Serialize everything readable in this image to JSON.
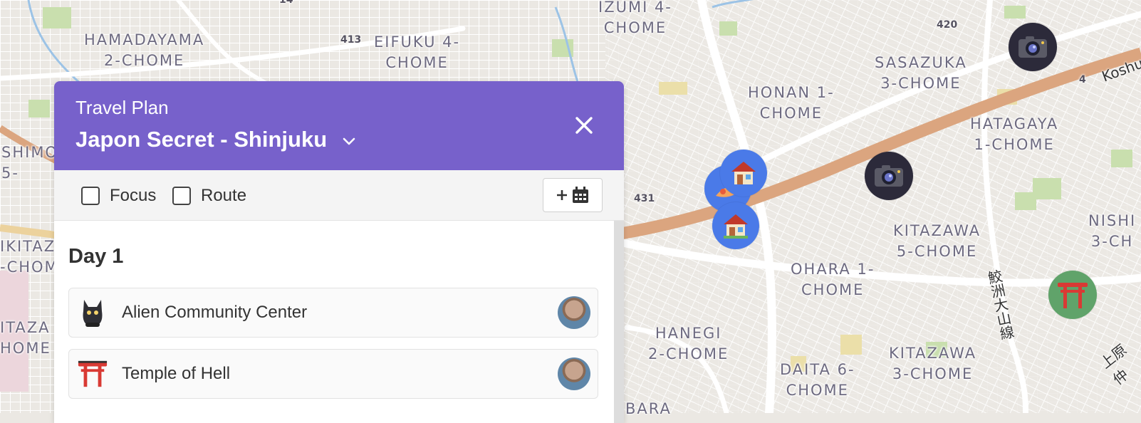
{
  "map": {
    "area_labels": [
      {
        "id": "hamadayama",
        "text": "HAMADAYAMA\n2-CHOME"
      },
      {
        "id": "eifuku",
        "text": "EIFUKU 4-\nCHOME"
      },
      {
        "id": "izumi",
        "text": "IZUMI 4-\nCHOME"
      },
      {
        "id": "sasazuka",
        "text": "SASAZUKA\n3-CHOME"
      },
      {
        "id": "honan",
        "text": "HONAN 1-\nCHOME"
      },
      {
        "id": "hatagaya",
        "text": "HATAGAYA\n1-CHOME"
      },
      {
        "id": "kitazawa5",
        "text": "KITAZAWA\n5-CHOME"
      },
      {
        "id": "ohara",
        "text": "OHARA 1-\nCHOME"
      },
      {
        "id": "hanegi",
        "text": "HANEGI\n2-CHOME"
      },
      {
        "id": "daita",
        "text": "DAITA 6-\nCHOME"
      },
      {
        "id": "kitazawa3",
        "text": "KITAZAWA\n3-CHOME"
      },
      {
        "id": "nishi",
        "text": "NISHI\n3-CH"
      },
      {
        "id": "shimo",
        "text": "SHIMO\n5-"
      },
      {
        "id": "ikitaz",
        "text": "IKITAZ\n-CHOM"
      },
      {
        "id": "itaza",
        "text": "ITAZA\nHOME"
      },
      {
        "id": "bara",
        "text": "BARA"
      }
    ],
    "road_numbers": [
      "413",
      "420",
      "431",
      "4",
      "14"
    ],
    "road_names": [
      "Koshu",
      "鮫洲大山線",
      "上原仲"
    ]
  },
  "panel": {
    "subtitle": "Travel Plan",
    "plan_name": "Japon Secret - Shinjuku",
    "toolbar": {
      "focus_label": "Focus",
      "route_label": "Route"
    },
    "day_title": "Day 1",
    "items": [
      {
        "label": "Alien Community Center",
        "icon": "cat-icon"
      },
      {
        "label": "Temple of Hell",
        "icon": "torii-gate-icon"
      }
    ]
  },
  "colors": {
    "header": "#7761cb",
    "highway": "#dba57f",
    "marker_blue": "#4a7ae8",
    "marker_dark": "#2c2a3a",
    "marker_green": "#60a36a"
  }
}
